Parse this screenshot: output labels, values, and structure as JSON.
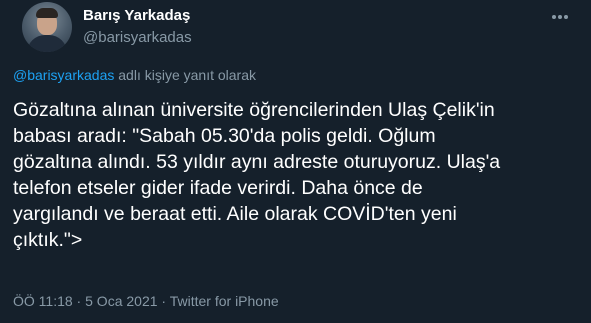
{
  "author": {
    "display_name": "Barış Yarkadaş",
    "handle": "@barisyarkadas",
    "avatar_icon": "avatar-photo"
  },
  "reply_context": {
    "mention": "@barisyarkadas",
    "suffix": " adlı kişiye yanıt olarak"
  },
  "tweet": {
    "text": "Gözaltına alınan üniversite öğrencilerinden Ulaş Çelik'in\nbabası aradı: \"Sabah 05.30'da polis geldi. Oğlum\ngözaltına alındı. 53 yıldır aynı adreste oturuyoruz. Ulaş'a\ntelefon etseler gider ifade verirdi. Daha önce de\nyargılandı ve beraat etti. Aile olarak COVİD'ten yeni\nçıktık.\">"
  },
  "meta": {
    "time": "ÖÖ 11:18",
    "separator": " · ",
    "date": "5 Oca 2021",
    "source": "Twitter for iPhone"
  },
  "menu": {
    "icon": "more-horizontal-icon"
  },
  "colors": {
    "background": "#15202b",
    "text_primary": "#ffffff",
    "text_secondary": "#8899a6",
    "accent": "#1da1f2"
  }
}
